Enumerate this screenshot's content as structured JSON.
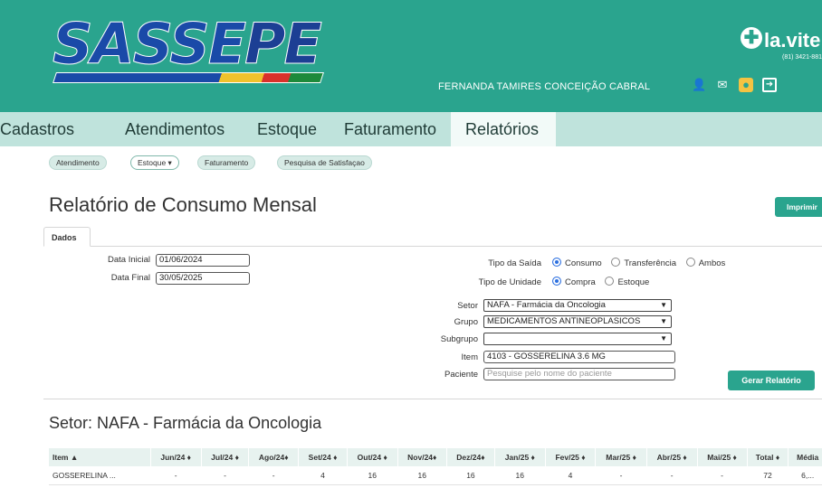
{
  "header": {
    "logo_text_part1": "SASSE",
    "logo_text_part2": "PE",
    "user_name": "FERNANDA TAMIRES CONCEIÇÃO CABRAL",
    "brand_name": "la.vite",
    "brand_phone": "(81) 3421-881",
    "colors": {
      "header_bg": "#2aa48e",
      "nav_bg": "#bfe3dc",
      "accent": "#2aa48e"
    },
    "icons": [
      "user-icon",
      "mail-icon",
      "chat-icon",
      "logout-icon"
    ]
  },
  "nav": {
    "items": [
      "Cadastros",
      "Atendimentos",
      "Estoque",
      "Faturamento",
      "Relatórios"
    ],
    "active": "Relatórios"
  },
  "subnav": {
    "items": [
      "Atendimento",
      "Estoque ▾",
      "Faturamento",
      "Pesquisa de Satisfaçao"
    ]
  },
  "page": {
    "title": "Relatório de Consumo Mensal",
    "print_button": "Imprimir",
    "tab": "Dados"
  },
  "form": {
    "data_inicial": {
      "label": "Data Inicial",
      "value": "01/06/2024"
    },
    "data_final": {
      "label": "Data Final",
      "value": "30/05/2025"
    },
    "tipo_saida": {
      "label": "Tipo da Saída",
      "options": [
        "Consumo",
        "Transferência",
        "Ambos"
      ],
      "selected": "Consumo"
    },
    "tipo_unidade": {
      "label": "Tipo de Unidade",
      "options": [
        "Compra",
        "Estoque"
      ],
      "selected": "Compra"
    },
    "setor": {
      "label": "Setor",
      "value": "NAFA - Farmácia da Oncologia"
    },
    "grupo": {
      "label": "Grupo",
      "value": "MEDICAMENTOS ANTINEOPLASICOS"
    },
    "subgrupo": {
      "label": "Subgrupo",
      "value": ""
    },
    "item": {
      "label": "Item",
      "value": "4103 - GOSSERELINA 3.6 MG"
    },
    "paciente": {
      "label": "Paciente",
      "placeholder": "Pesquise pelo nome do paciente"
    },
    "submit": "Gerar Relatório"
  },
  "section": {
    "title": "Setor: NAFA - Farmácia da Oncologia"
  },
  "table": {
    "columns": [
      "Item ▲",
      "Jun/24 ♦",
      "Jul/24 ♦",
      "Ago/24♦",
      "Set/24 ♦",
      "Out/24 ♦",
      "Nov/24♦",
      "Dez/24♦",
      "Jan/25 ♦",
      "Fev/25 ♦",
      "Mar/25 ♦",
      "Abr/25 ♦",
      "Mai/25 ♦",
      "Total ♦",
      "Média"
    ],
    "rows": [
      [
        "GOSSERELINA ...",
        "-",
        "-",
        "-",
        "4",
        "16",
        "16",
        "16",
        "16",
        "4",
        "-",
        "-",
        "-",
        "72",
        "6,..."
      ]
    ]
  }
}
